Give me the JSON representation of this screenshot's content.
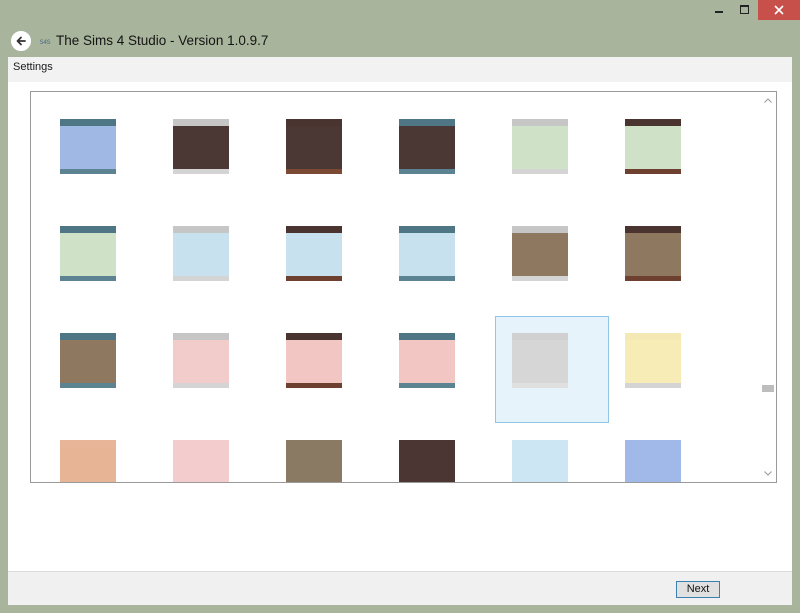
{
  "window": {
    "title": "The Sims 4 Studio - Version 1.0.9.7",
    "app_icon_text": "S4S",
    "controls": [
      "minimize-icon",
      "maximize-icon",
      "close-icon"
    ],
    "close_color": "#c7504b",
    "frame_color": "#a8b49b"
  },
  "menu": {
    "settings_label": "Settings"
  },
  "grid": {
    "selected_index": 16,
    "selection_colors": {
      "background": "#e6f3fb",
      "border": "#8fc7e6"
    },
    "tiles": [
      {
        "top": "#4f7684",
        "mid": "#9fb9e4",
        "bot": "#5c8391"
      },
      {
        "top": "#c6c6c6",
        "mid": "#4b3734",
        "bot": "#d4d4d4"
      },
      {
        "top": "#4a3430",
        "mid": "#4b3734",
        "bot": "#7b4a34"
      },
      {
        "top": "#4f7684",
        "mid": "#4b3734",
        "bot": "#5c8391"
      },
      {
        "top": "#c6c6c6",
        "mid": "#cfe2c8",
        "bot": "#d4d4d4"
      },
      {
        "top": "#4a3430",
        "mid": "#cfe2c8",
        "bot": "#6e4030"
      },
      {
        "top": "#4f7684",
        "mid": "#cfe2c8",
        "bot": "#5c8391"
      },
      {
        "top": "#c6c6c6",
        "mid": "#c7e1ee",
        "bot": "#d4d4d4"
      },
      {
        "top": "#4a3430",
        "mid": "#c7e1ee",
        "bot": "#6e4030"
      },
      {
        "top": "#4f7684",
        "mid": "#c7e1ee",
        "bot": "#5c8391"
      },
      {
        "top": "#c6c6c6",
        "mid": "#8f7860",
        "bot": "#d4d4d4"
      },
      {
        "top": "#4a3430",
        "mid": "#8f7860",
        "bot": "#6e4030"
      },
      {
        "top": "#4f7684",
        "mid": "#8f7860",
        "bot": "#5c8391"
      },
      {
        "top": "#c6c6c6",
        "mid": "#f2cbcb",
        "bot": "#d4d4d4"
      },
      {
        "top": "#4a3430",
        "mid": "#f2c7c3",
        "bot": "#6e4030"
      },
      {
        "top": "#4f7684",
        "mid": "#f2c7c3",
        "bot": "#5c8391"
      },
      {
        "top": "#d0d0d0",
        "mid": "#d6d6d6",
        "bot": "#e0e0e0"
      },
      {
        "top": "#f4e9b4",
        "mid": "#f8ecb6",
        "bot": "#d4d4d4"
      },
      {
        "top": "#e9b598",
        "mid": "#e8b496",
        "bot": "#e8b496"
      },
      {
        "top": "#f3cdcd",
        "mid": "#f3cdcd",
        "bot": "#f3cdcd"
      },
      {
        "top": "#8b7a63",
        "mid": "#8b7a63",
        "bot": "#8b7a63"
      },
      {
        "top": "#4c3633",
        "mid": "#4c3633",
        "bot": "#4c3633"
      },
      {
        "top": "#cde6f3",
        "mid": "#cde6f3",
        "bot": "#cde6f3"
      },
      {
        "top": "#a1b9e8",
        "mid": "#a1b9e8",
        "bot": "#a1b9e8"
      }
    ]
  },
  "footer": {
    "next_label": "Next"
  }
}
